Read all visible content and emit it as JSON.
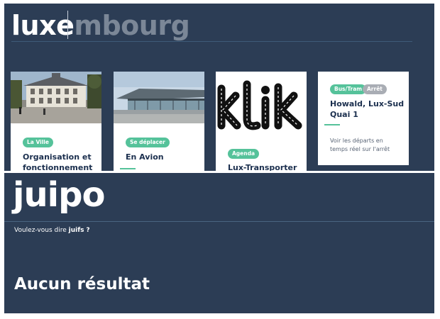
{
  "search_top": {
    "typed": "luxe",
    "autocomplete_rest": "mbourg"
  },
  "cards": [
    {
      "badge": "La Ville",
      "title": "Organisation et fonctionnement"
    },
    {
      "badge": "Se déplacer",
      "title": "En Avion"
    },
    {
      "badge": "Agenda",
      "title": "Lux-Transporter",
      "image_text": "klik"
    },
    {
      "badges": [
        "Bus/Tram",
        "Arrêt"
      ],
      "title": "Howald, Lux-Sud Quai 1",
      "description": "Voir les départs en temps réel sur l'arrêt"
    }
  ],
  "search_bottom": {
    "query": "juipo",
    "suggestion_prefix": "Voulez-vous dire",
    "suggestion_word": "juifs",
    "suggestion_suffix": "?",
    "no_result": "Aucun résultat"
  },
  "colors": {
    "background": "#2c3d55",
    "accent": "#55c29a",
    "title": "#1b2f4e"
  }
}
